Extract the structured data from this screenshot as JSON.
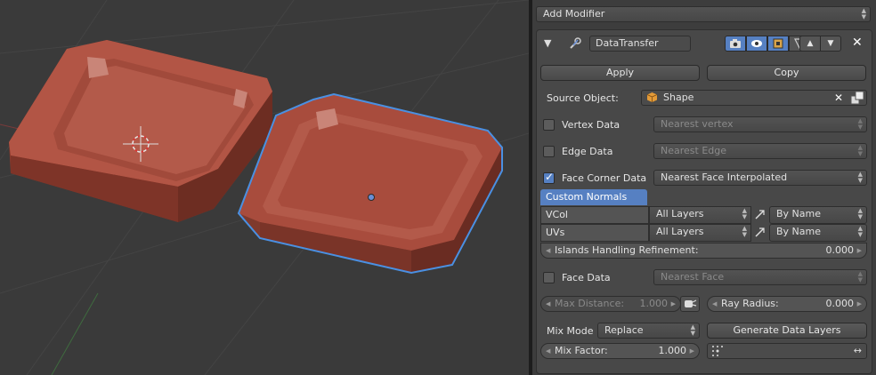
{
  "colors": {
    "accent": "#5680c2",
    "selection_outline": "#4a90e2",
    "object_fill": "#a84c3d"
  },
  "viewport": {
    "icons": [
      "3d-cursor-icon",
      "object-origin-icon"
    ]
  },
  "panel": {
    "add_modifier": "Add Modifier",
    "modifier_name": "DataTransfer",
    "apply_label": "Apply",
    "copy_label": "Copy",
    "source_object_label": "Source Object:",
    "source_object_value": "Shape",
    "vertex_data": {
      "label": "Vertex Data",
      "checked": false,
      "mode": "Nearest vertex"
    },
    "edge_data": {
      "label": "Edge Data",
      "checked": false,
      "mode": "Nearest Edge"
    },
    "face_corner_data": {
      "label": "Face Corner Data",
      "checked": true,
      "mode": "Nearest Face Interpolated"
    },
    "custom_normals_label": "Custom Normals",
    "vcol": {
      "label": "VCol",
      "layers": "All Layers",
      "mapping": "By Name"
    },
    "uvs": {
      "label": "UVs",
      "layers": "All Layers",
      "mapping": "By Name"
    },
    "islands": {
      "label": "Islands Handling Refinement:",
      "value": "0.000"
    },
    "face_data": {
      "label": "Face Data",
      "checked": false,
      "mode": "Nearest Face"
    },
    "max_distance": {
      "label": "Max Distance:",
      "value": "1.000"
    },
    "ray_radius": {
      "label": "Ray Radius:",
      "value": "0.000"
    },
    "mix_mode_label": "Mix Mode",
    "mix_mode_value": "Replace",
    "generate_label": "Generate Data Layers",
    "mix_factor": {
      "label": "Mix Factor:",
      "value": "1.000"
    }
  }
}
